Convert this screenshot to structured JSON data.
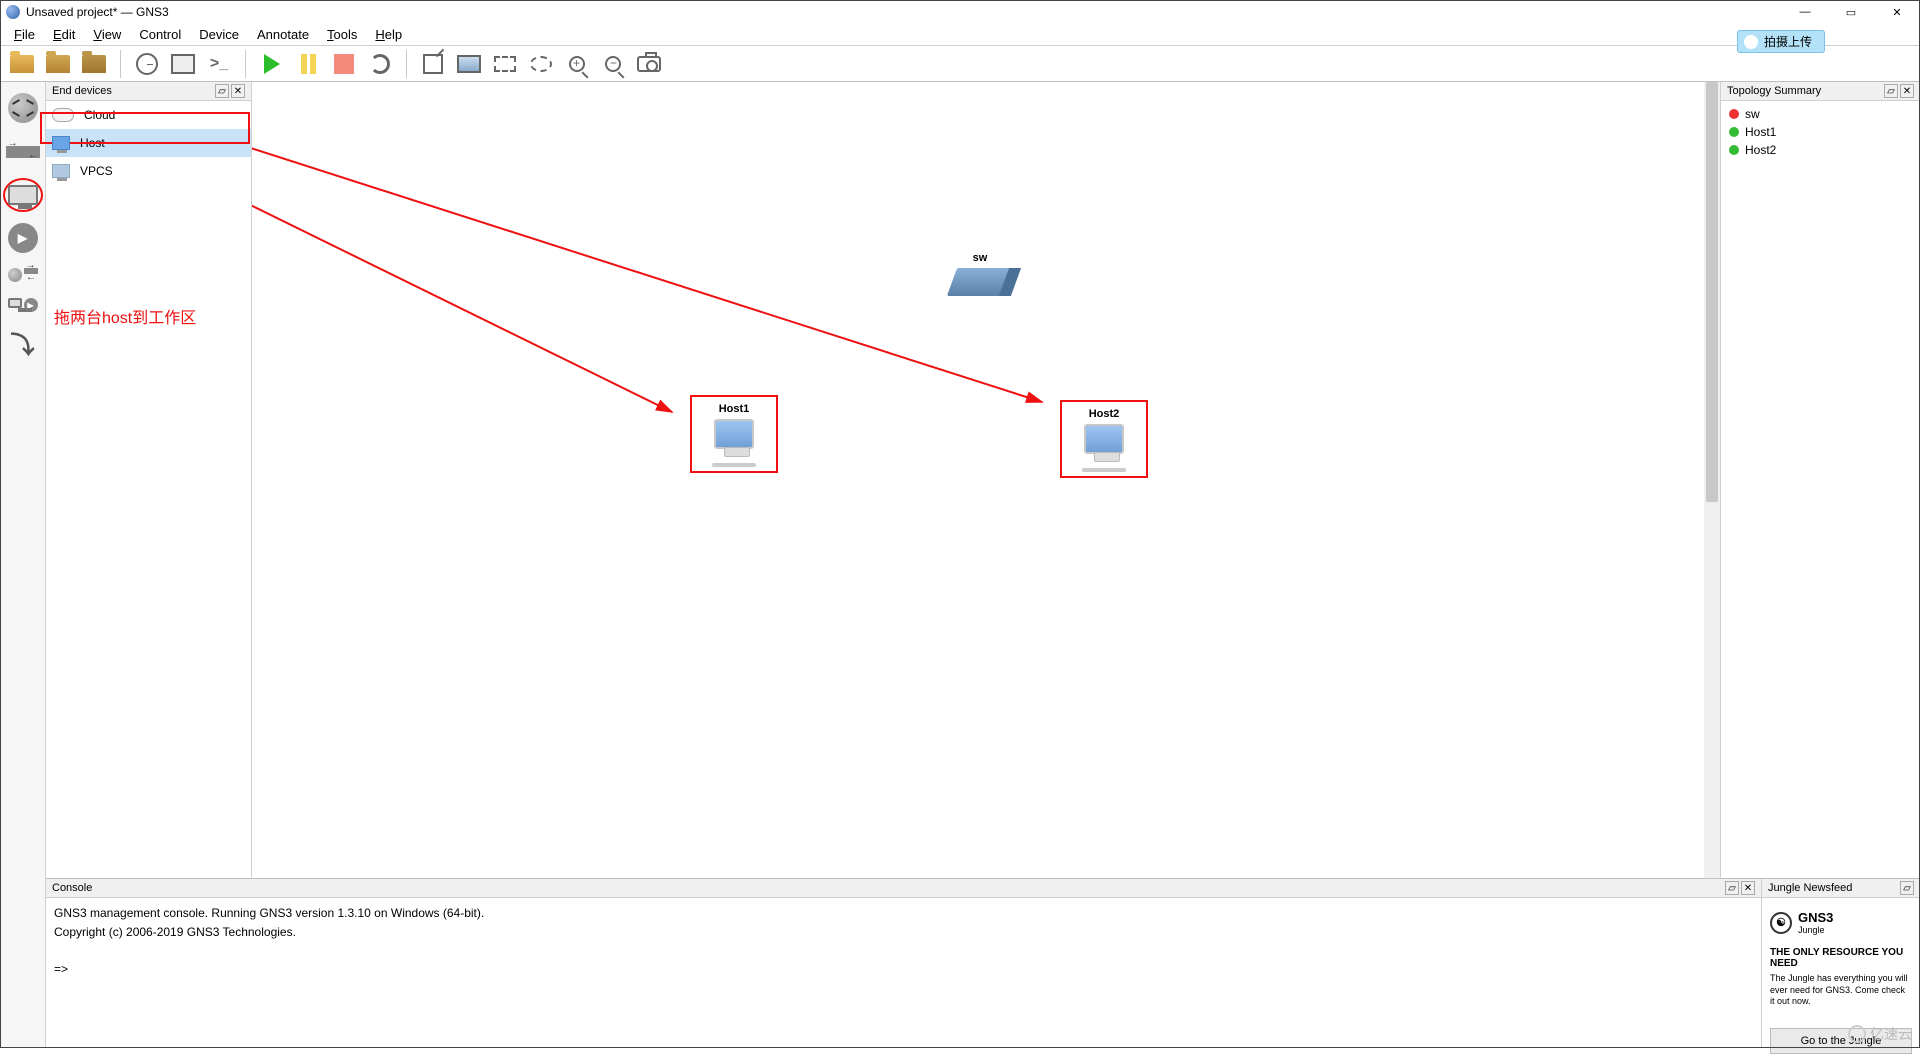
{
  "window": {
    "title": "Unsaved project* — GNS3"
  },
  "win_controls": {
    "min": "—",
    "max": "▭",
    "close": "✕"
  },
  "menu": {
    "file": "File",
    "edit": "Edit",
    "view": "View",
    "control": "Control",
    "device": "Device",
    "annotate": "Annotate",
    "tools": "Tools",
    "help": "Help"
  },
  "topright_button": "拍摄上传",
  "panels": {
    "devices_title": "End devices",
    "topology_title": "Topology Summary",
    "console_title": "Console",
    "jungle_title": "Jungle Newsfeed"
  },
  "devices": {
    "items": [
      {
        "label": "Cloud"
      },
      {
        "label": "Host"
      },
      {
        "label": "VPCS"
      }
    ]
  },
  "canvas": {
    "switch_label": "sw",
    "host1_label": "Host1",
    "host2_label": "Host2"
  },
  "topology": {
    "items": [
      {
        "label": "sw",
        "status": "red"
      },
      {
        "label": "Host1",
        "status": "green"
      },
      {
        "label": "Host2",
        "status": "green"
      }
    ]
  },
  "console": {
    "line1": "GNS3 management console. Running GNS3 version 1.3.10 on Windows (64-bit).",
    "line2": "Copyright (c) 2006-2019 GNS3 Technologies.",
    "prompt": "=>"
  },
  "jungle": {
    "brand": "GNS3",
    "brand_sub": "Jungle",
    "headline": "THE ONLY RESOURCE YOU NEED",
    "desc": "The Jungle has everything you will ever need for GNS3. Come check it out now.",
    "button": "Go to the Jungle"
  },
  "annotation": {
    "text": "拖两台host到工作区"
  },
  "watermark": "亿速云"
}
